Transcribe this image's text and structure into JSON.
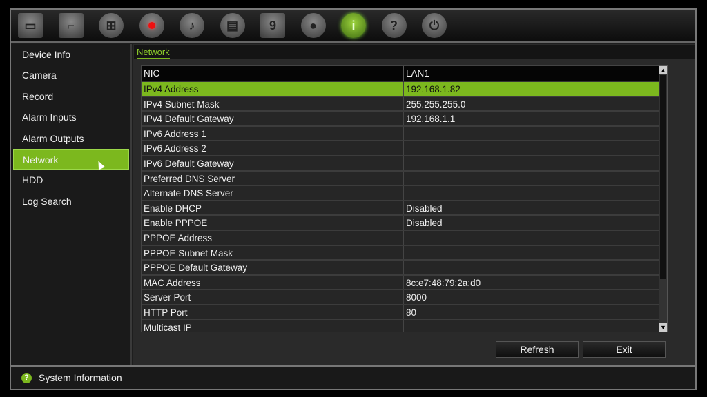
{
  "toolbar": {
    "icons": [
      "monitor-icon",
      "camera-icon",
      "network-icon",
      "record-icon",
      "alarm-icon",
      "device-icon",
      "hdd-icon",
      "user-icon",
      "info-icon",
      "help-icon",
      "power-icon"
    ],
    "active": "info-icon",
    "accent": "#7cb81e"
  },
  "sidebar": {
    "items": [
      {
        "label": "Device Info"
      },
      {
        "label": "Camera"
      },
      {
        "label": "Record"
      },
      {
        "label": "Alarm Inputs"
      },
      {
        "label": "Alarm Outputs"
      },
      {
        "label": "Network"
      },
      {
        "label": "HDD"
      },
      {
        "label": "Log Search"
      }
    ],
    "active": "Network"
  },
  "breadcrumb": "Network",
  "table": {
    "headers": [
      "NIC",
      "LAN1"
    ],
    "rows": [
      [
        "IPv4 Address",
        "192.168.1.82"
      ],
      [
        "IPv4 Subnet Mask",
        "255.255.255.0"
      ],
      [
        "IPv4 Default Gateway",
        "192.168.1.1"
      ],
      [
        "IPv6 Address 1",
        ""
      ],
      [
        "IPv6 Address 2",
        ""
      ],
      [
        "IPv6 Default Gateway",
        ""
      ],
      [
        "Preferred DNS Server",
        ""
      ],
      [
        "Alternate DNS Server",
        ""
      ],
      [
        "Enable DHCP",
        "Disabled"
      ],
      [
        "Enable PPPOE",
        "Disabled"
      ],
      [
        "PPPOE Address",
        ""
      ],
      [
        "PPPOE Subnet Mask",
        ""
      ],
      [
        "PPPOE Default Gateway",
        ""
      ],
      [
        "MAC Address",
        "8c:e7:48:79:2a:d0"
      ],
      [
        "Server Port",
        "8000"
      ],
      [
        "HTTP Port",
        "80"
      ],
      [
        "Multicast IP",
        ""
      ]
    ],
    "selected_row": 0
  },
  "buttons": {
    "refresh": "Refresh",
    "exit": "Exit"
  },
  "status": {
    "text": "System Information",
    "icon": "help-icon"
  }
}
